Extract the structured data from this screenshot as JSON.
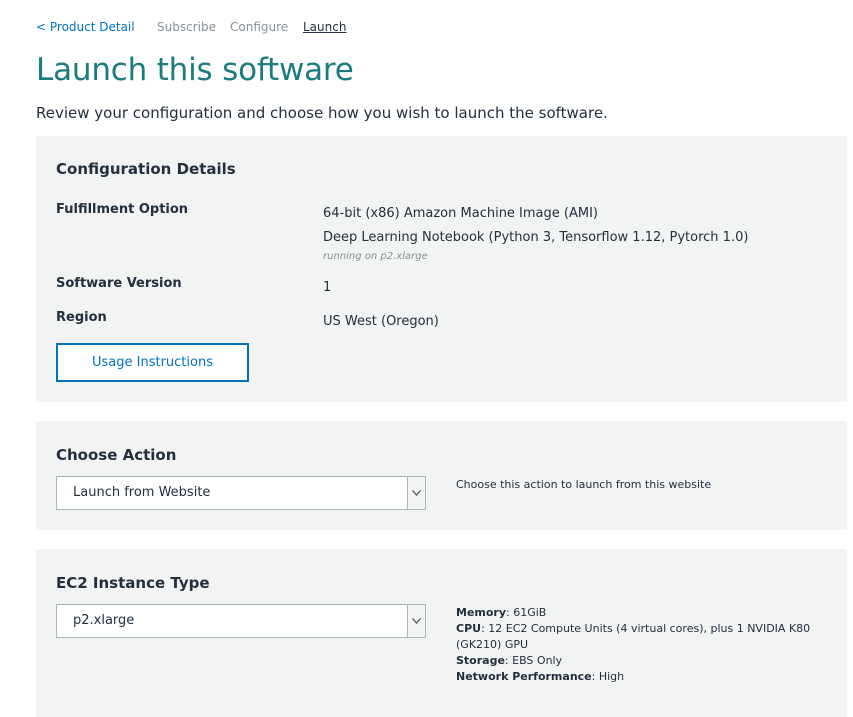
{
  "breadcrumb": {
    "back": "< Product Detail",
    "subscribe": "Subscribe",
    "configure": "Configure",
    "launch": "Launch"
  },
  "page": {
    "title": "Launch this software",
    "subtitle": "Review your configuration and choose how you wish to launch the software."
  },
  "config": {
    "title": "Configuration Details",
    "fulfillment_label": "Fulfillment Option",
    "fulfillment_value1": "64-bit (x86) Amazon Machine Image (AMI)",
    "fulfillment_value2": "Deep Learning Notebook (Python 3, Tensorflow 1.12, Pytorch 1.0)",
    "fulfillment_note": "running on p2.xlarge",
    "version_label": "Software Version",
    "version_value": "1",
    "region_label": "Region",
    "region_value": "US West (Oregon)",
    "usage_button": "Usage Instructions"
  },
  "action": {
    "title": "Choose Action",
    "selected": "Launch from Website",
    "help": "Choose this action to launch from this website"
  },
  "ec2": {
    "title": "EC2 Instance Type",
    "selected": "p2.xlarge",
    "memory_label": "Memory",
    "memory_value": ": 61GiB",
    "cpu_label": "CPU",
    "cpu_value": ": 12 EC2 Compute Units (4 virtual cores), plus 1 NVIDIA K80 (GK210) GPU",
    "storage_label": "Storage",
    "storage_value": ": EBS Only",
    "network_label": "Network Performance",
    "network_value": ": High"
  },
  "icons": {
    "dropdown": "chevron-down-icon"
  },
  "colors": {
    "title": "#1b7c7f",
    "link": "#0073bb",
    "panel": "#f2f3f3"
  }
}
